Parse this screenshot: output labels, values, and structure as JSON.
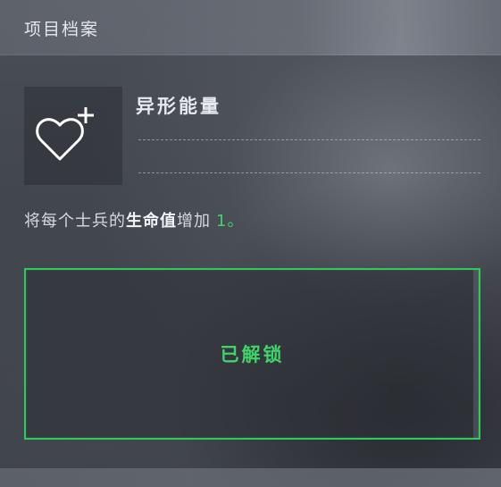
{
  "header": {
    "title": "项目档案"
  },
  "ability": {
    "icon": "heart-plus-icon",
    "name": "异形能量"
  },
  "description": {
    "prefix": "将每个士兵的",
    "highlight": "生命值",
    "middle": "增加",
    "value": "1。"
  },
  "status": {
    "label": "已解锁"
  },
  "colors": {
    "accent_green": "#2ec95c",
    "value_green": "#3fd46a"
  }
}
